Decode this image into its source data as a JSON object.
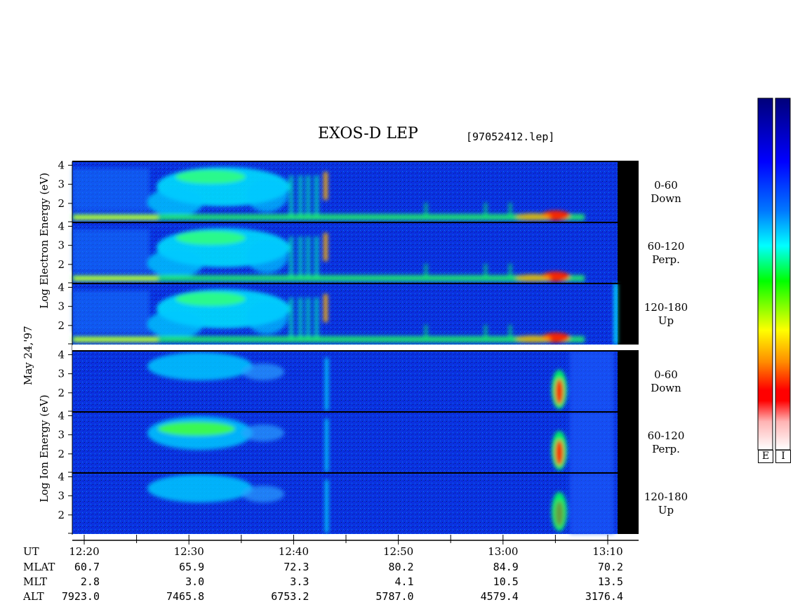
{
  "header": {
    "title": "EXOS-D LEP",
    "file_tag": "[97052412.lep]"
  },
  "labels": {
    "date": "May 24,'97",
    "electron_axis": "Log  Electron  Energy (eV)",
    "ion_axis": "Log  Ion  Energy (eV)"
  },
  "chart_data": {
    "type": "heatmap",
    "title": "EXOS-D LEP",
    "panels": [
      {
        "species": "Electron",
        "pitch_angle": "0-60",
        "direction": "Down",
        "yticks": [
          "4",
          "3",
          "2"
        ]
      },
      {
        "species": "Electron",
        "pitch_angle": "60-120",
        "direction": "Perp.",
        "yticks": [
          "4",
          "3",
          "2"
        ]
      },
      {
        "species": "Electron",
        "pitch_angle": "120-180",
        "direction": "Up",
        "yticks": [
          "4",
          "3",
          "2"
        ]
      },
      {
        "species": "Ion",
        "pitch_angle": "0-60",
        "direction": "Down",
        "yticks": [
          "4",
          "3",
          "2"
        ]
      },
      {
        "species": "Ion",
        "pitch_angle": "60-120",
        "direction": "Perp.",
        "yticks": [
          "4",
          "3",
          "2"
        ]
      },
      {
        "species": "Ion",
        "pitch_angle": "120-180",
        "direction": "Up",
        "yticks": [
          "4",
          "3",
          "2"
        ]
      }
    ],
    "ylim": [
      1,
      4.2
    ],
    "x_axis": {
      "rows": [
        "UT",
        "MLAT",
        "MLT",
        "ALT"
      ],
      "ticks": [
        {
          "ut": "12:20",
          "mlat": "60.7",
          "mlt": "2.8",
          "alt": "7923.0"
        },
        {
          "ut": "12:30",
          "mlat": "65.9",
          "mlt": "3.0",
          "alt": "7465.8"
        },
        {
          "ut": "12:40",
          "mlat": "72.3",
          "mlt": "3.3",
          "alt": "6753.2"
        },
        {
          "ut": "12:50",
          "mlat": "80.2",
          "mlt": "4.1",
          "alt": "5787.0"
        },
        {
          "ut": "13:00",
          "mlat": "84.9",
          "mlt": "10.5",
          "alt": "4579.4"
        },
        {
          "ut": "13:10",
          "mlat": "70.2",
          "mlt": "13.5",
          "alt": "3176.4"
        }
      ]
    },
    "colorbars": [
      {
        "label": "E"
      },
      {
        "label": "I"
      }
    ],
    "colors": [
      "#00007a",
      "#0000ff",
      "#0078ff",
      "#00ffff",
      "#00ff00",
      "#ffff00",
      "#ff8c00",
      "#ff0000",
      "#ffb4b4",
      "#ffffff"
    ]
  }
}
